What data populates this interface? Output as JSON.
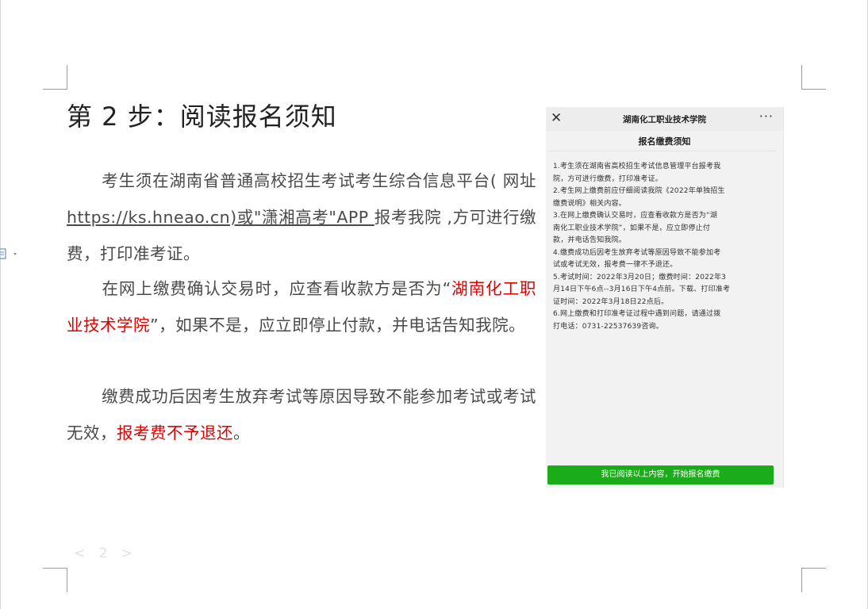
{
  "document": {
    "heading": "第 2 步：阅读报名须知",
    "para1": {
      "before": "考生须在湖南省普通高校招生考试考生综合信息平台( 网址  ",
      "link": "https://ks.hneao.cn)或\"潇湘高考\"APP ",
      "after": "报考我院 ,方可进行缴费，打印准考证。"
    },
    "para2": {
      "before": "在网上缴费确认交易时，应查看收款方是否为“",
      "red": "湖南化工职业技术学院",
      "after": "”，如果不是，应立即停止付款，并电话告知我院。"
    },
    "para3": {
      "before": "缴费成功后因考生放弃考试等原因导致不能参加考试或考试无效，",
      "red": "报考费不予退还",
      "after": "。"
    },
    "page_number": "< 2 >"
  },
  "phone": {
    "close": "✕",
    "title": "湖南化工职业技术学院",
    "more": "···",
    "subtitle": "报名缴费须知",
    "lines": [
      "1.考生须在湖南省高校招生考试信息管理平台报考我",
      "院，方可进行缴费，打印准考证。",
      "2.考生网上缴费前应仔细阅读我院《2022年单独招生",
      "缴费说明》相关内容。",
      "3.在网上缴费确认交易时，应查看收款方是否为“湖",
      "南化工职业技术学院”，如果不是，应立即停止付",
      "款，并电话告知我院。",
      "4.缴费成功后因考生放弃考试等原因导致不能参加考",
      "试或考试无效，报考费一律不予退还。",
      "5.考试时间：2022年3月20日；缴费时间：2022年3",
      "月14日下午6点--3月16日下午4点前。下载、打印准考",
      "证时间：2022年3月18日22点后。",
      "6.网上缴费和打印准考证过程中遇到问题，请通过拨",
      "打电话：0731-22537639咨询。"
    ],
    "button": "我已阅读以上内容，开始报名缴费"
  },
  "colors": {
    "red": "#e00000",
    "button_green": "#1aad19"
  }
}
